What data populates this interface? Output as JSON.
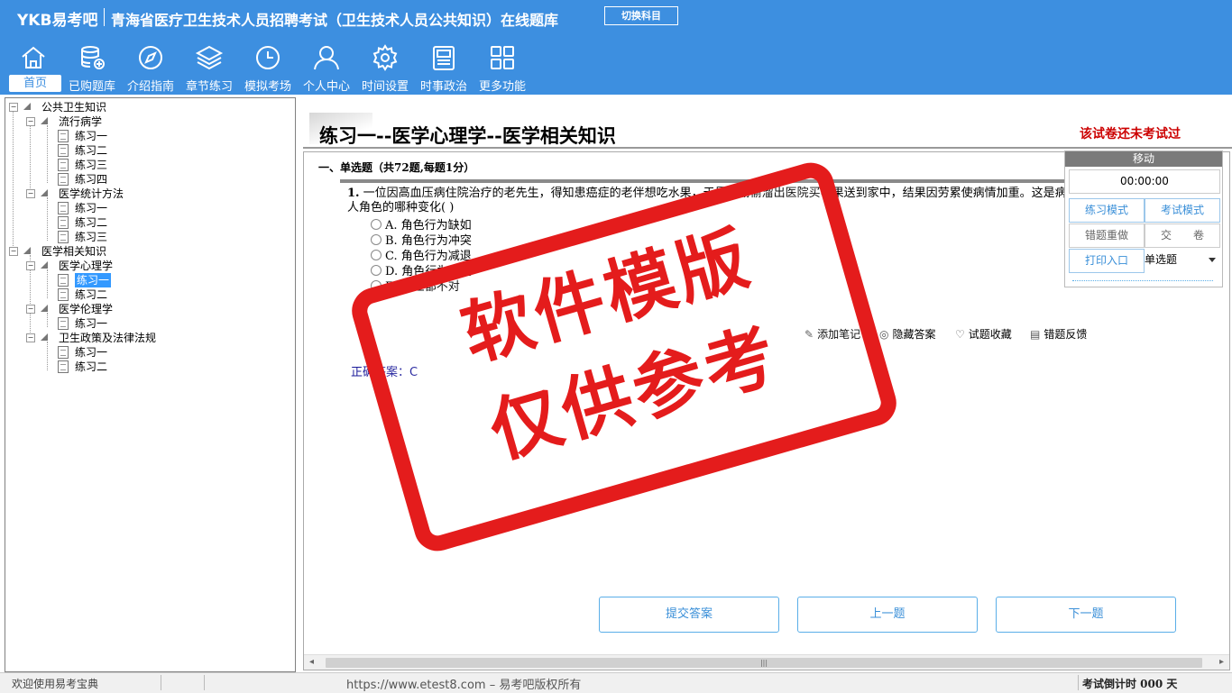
{
  "header": {
    "logo": "YKB易考吧",
    "title": "青海省医疗卫生技术人员招聘考试（卫生技术人员公共知识）在线题库",
    "switch_label": "切换科目",
    "nav": [
      {
        "label": "首页",
        "icon": "home-icon"
      },
      {
        "label": "已购题库",
        "icon": "database-icon"
      },
      {
        "label": "介绍指南",
        "icon": "compass-icon"
      },
      {
        "label": "章节练习",
        "icon": "layers-icon"
      },
      {
        "label": "模拟考场",
        "icon": "clock-icon"
      },
      {
        "label": "个人中心",
        "icon": "user-icon"
      },
      {
        "label": "时间设置",
        "icon": "gear-icon"
      },
      {
        "label": "时事政治",
        "icon": "news-icon"
      },
      {
        "label": "更多功能",
        "icon": "grid-icon"
      }
    ]
  },
  "tree": {
    "nodes": [
      {
        "label": "公共卫生知识"
      },
      {
        "label": "流行病学"
      },
      {
        "label": "练习一"
      },
      {
        "label": "练习二"
      },
      {
        "label": "练习三"
      },
      {
        "label": "练习四"
      },
      {
        "label": "医学统计方法"
      },
      {
        "label": "练习一"
      },
      {
        "label": "练习二"
      },
      {
        "label": "练习三"
      },
      {
        "label": "医学相关知识"
      },
      {
        "label": "医学心理学"
      },
      {
        "label": "练习一"
      },
      {
        "label": "练习二"
      },
      {
        "label": "医学伦理学"
      },
      {
        "label": "练习一"
      },
      {
        "label": "卫生政策及法律法规"
      },
      {
        "label": "练习一"
      },
      {
        "label": "练习二"
      }
    ]
  },
  "main": {
    "paper_title": "练习一--医学心理学--医学相关知识",
    "status": "该试卷还未考试过",
    "section_header": "一、单选题（共72题,每题1分）",
    "question": {
      "number": "1.",
      "text": "一位因高血压病住院治疗的老先生，得知患癌症的老伴想吃水果，于是他偷偷溜出医院买苹果送到家中，结果因劳累使病情加重。这是病人角色的哪种变化( )",
      "options": [
        "A. 角色行为缺如",
        "B. 角色行为冲突",
        "C. 角色行为减退",
        "D. 角色行为强化",
        "E. 以上都不对"
      ]
    },
    "actions": {
      "add_note": "添加笔记",
      "hide_answer": "隐藏答案",
      "favorite": "试题收藏",
      "feedback": "错题反馈"
    },
    "answer": "正确答案：C",
    "buttons": {
      "submit": "提交答案",
      "prev": "上一题",
      "next": "下一题"
    }
  },
  "panel": {
    "move": "移动",
    "timer": "00:00:00",
    "practice_mode": "练习模式",
    "exam_mode": "考试模式",
    "redo_wrong": "错题重做",
    "hand_in": "交　　卷",
    "print": "打印入口",
    "question_type": "单选题"
  },
  "statusbar": {
    "welcome": "欢迎使用易考宝典",
    "url": "https://www.etest8.com – 易考吧版权所有",
    "exam_countdown": "考试倒计时 000 天"
  },
  "watermark": {
    "line1": "软件模版",
    "line2": "仅供参考"
  },
  "colors": {
    "header_bg": "#3d8fe0",
    "accent": "#3a8fd8",
    "status_red": "#cc0000",
    "stamp_red": "#e41c1c"
  }
}
